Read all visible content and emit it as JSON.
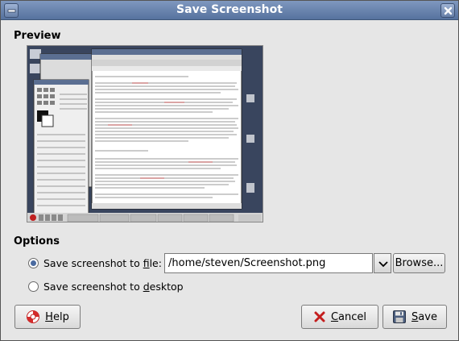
{
  "window": {
    "title": "Save Screenshot",
    "titlebar_color": "#6a83ad"
  },
  "preview": {
    "heading": "Preview"
  },
  "options": {
    "heading": "Options",
    "save_to_file_prefix": "Save screenshot to ",
    "save_to_file_mnemonic": "f",
    "save_to_file_suffix": "ile:",
    "save_to_desktop_prefix": "Save screenshot to ",
    "save_to_desktop_mnemonic": "d",
    "save_to_desktop_suffix": "esktop",
    "selected": "file"
  },
  "file_path": {
    "value": "/home/steven/Screenshot.png"
  },
  "buttons": {
    "browse": "Browse...",
    "help_mnemonic": "H",
    "help_rest": "elp",
    "cancel_mnemonic": "C",
    "cancel_rest": "ancel",
    "save_mnemonic": "S",
    "save_rest": "ave"
  }
}
